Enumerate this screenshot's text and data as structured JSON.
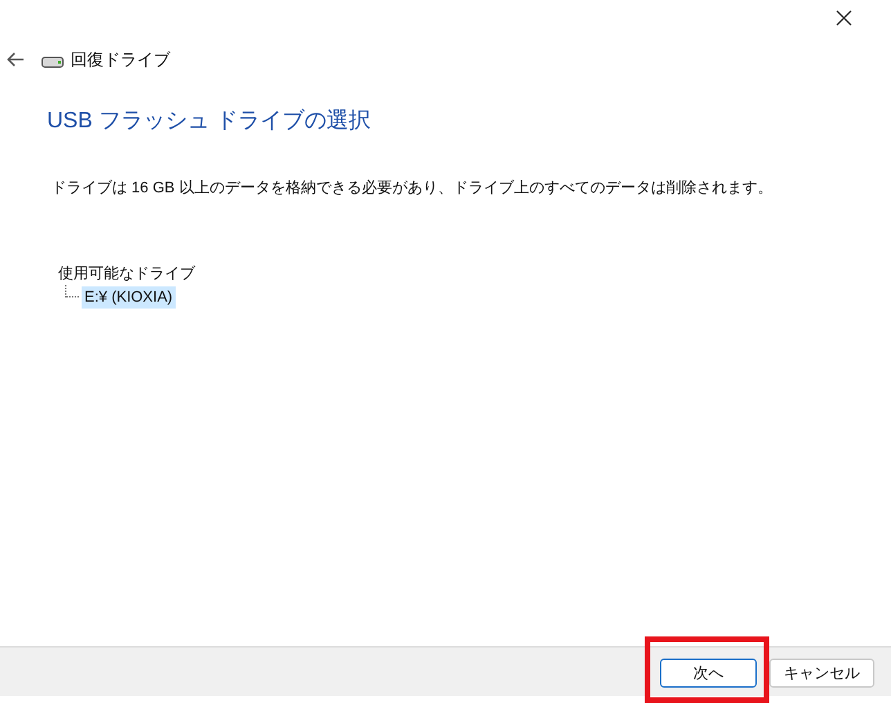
{
  "header": {
    "title": "回復ドライブ"
  },
  "heading": "USB フラッシュ ドライブの選択",
  "description": "ドライブは 16 GB 以上のデータを格納できる必要があり、ドライブ上のすべてのデータは削除されます。",
  "drive_tree": {
    "label": "使用可能なドライブ",
    "children": [
      {
        "label": "E:¥ (KIOXIA)",
        "selected": true
      }
    ]
  },
  "buttons": [
    {
      "label": "次へ",
      "default": true,
      "highlighted": true
    },
    {
      "label": "キャンセル",
      "default": false,
      "highlighted": false
    }
  ]
}
